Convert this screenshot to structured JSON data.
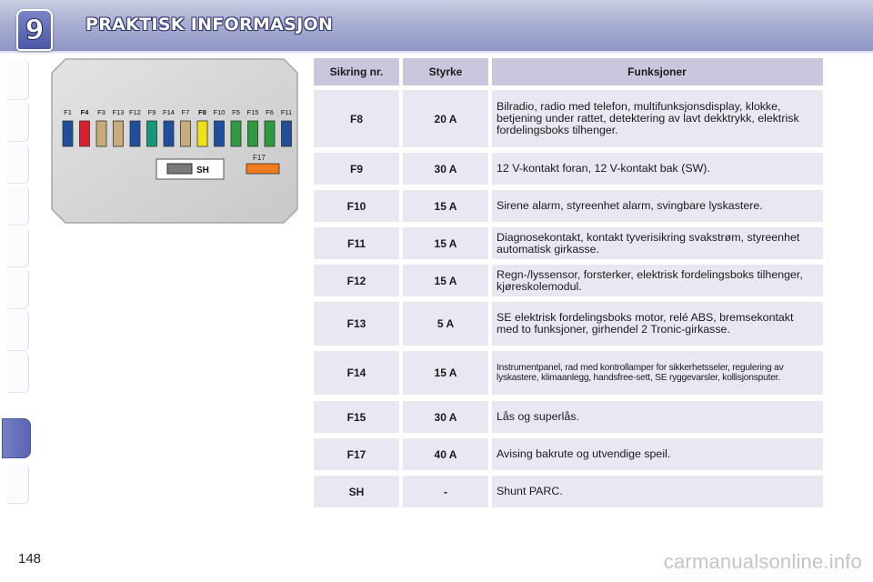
{
  "header": {
    "chapter_number": "9",
    "title": "PRAKTISK INFORMASJON"
  },
  "fusebox": {
    "fuse_labels": [
      "F1",
      "F4",
      "F3",
      "F13",
      "F12",
      "F9",
      "F14",
      "F7",
      "F8",
      "F10",
      "F5",
      "F15",
      "F6",
      "F11"
    ],
    "fuse_colors": [
      "#1f4e9a",
      "#d6202e",
      "#c9ab7c",
      "#c9ab7c",
      "#1f4e9a",
      "#16977a",
      "#1f4e9a",
      "#c9ab7c",
      "#f0e21a",
      "#1f4e9a",
      "#2e9b3e",
      "#2e9b3e",
      "#2e9b3e",
      "#1f4e9a"
    ],
    "shunt_label": "SH",
    "f17_label": "F17",
    "f17_color": "#f07a1e"
  },
  "table": {
    "headers": {
      "fuse_no": "Sikring nr.",
      "rating": "Styrke",
      "functions": "Funksjoner"
    },
    "rows": [
      {
        "fuse": "F8",
        "rating": "20 A",
        "function": "Bilradio, radio med telefon, multifunksjonsdisplay, klokke, betjening under rattet, detektering av lavt dekktrykk, elektrisk fordelingsboks tilhenger."
      },
      {
        "fuse": "F9",
        "rating": "30 A",
        "function": "12 V-kontakt foran, 12 V-kontakt bak (SW)."
      },
      {
        "fuse": "F10",
        "rating": "15 A",
        "function": "Sirene alarm, styreenhet alarm, svingbare lyskastere."
      },
      {
        "fuse": "F11",
        "rating": "15 A",
        "function": "Diagnosekontakt, kontakt tyverisikring svakstrøm, styreenhet automatisk girkasse."
      },
      {
        "fuse": "F12",
        "rating": "15 A",
        "function": "Regn-/lyssensor, forsterker, elektrisk fordelingsboks tilhenger, kjøreskolemodul."
      },
      {
        "fuse": "F13",
        "rating": "5 A",
        "function": "SE elektrisk fordelingsboks motor, relé ABS, bremsekontakt med to funksjoner, girhendel 2 Tronic-girkasse."
      },
      {
        "fuse": "F14",
        "rating": "15 A",
        "function": "Instrumentpanel, rad med kontrollamper for sikkerhetsseler, regulering av lyskastere, klimaanlegg, handsfree-sett, SE ryggevarsler, kollisjonsputer."
      },
      {
        "fuse": "F15",
        "rating": "30 A",
        "function": "Lås og superlås."
      },
      {
        "fuse": "F17",
        "rating": "40 A",
        "function": "Avising bakrute og utvendige speil."
      },
      {
        "fuse": "SH",
        "rating": "-",
        "function": "Shunt PARC."
      }
    ]
  },
  "page_number": "148",
  "watermark": "carmanualsonline.info"
}
